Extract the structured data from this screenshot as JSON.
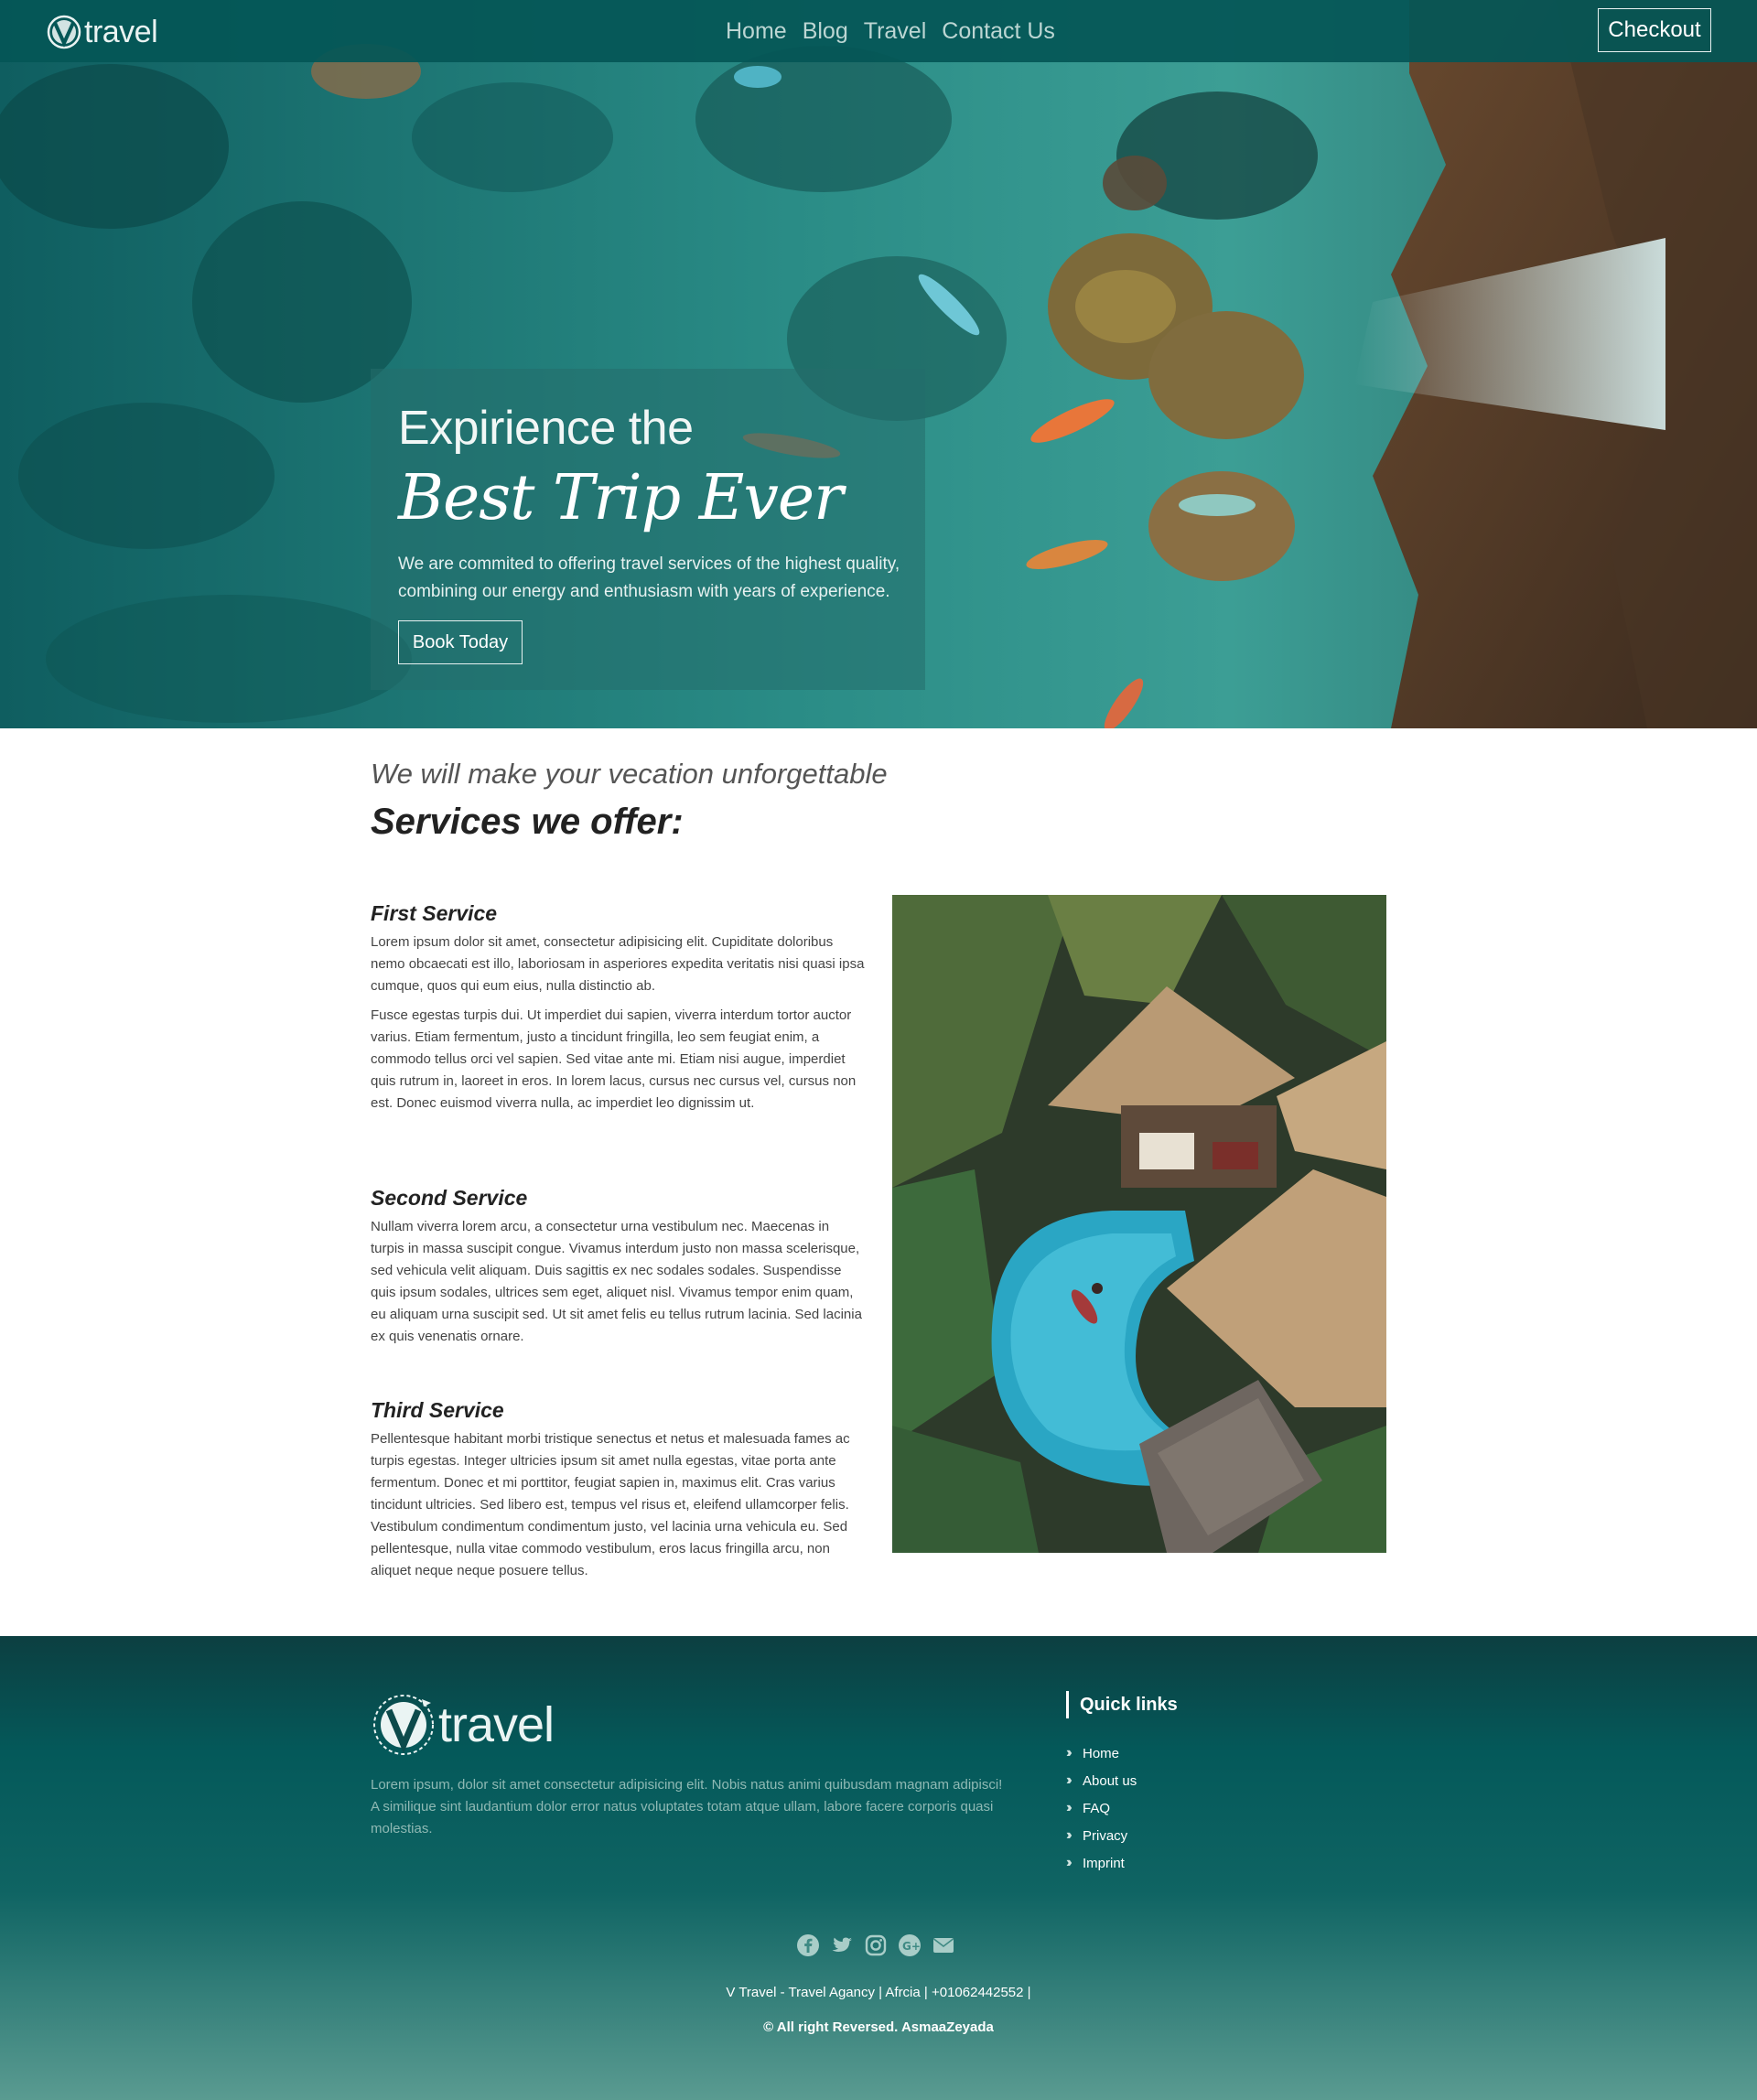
{
  "brand": {
    "logo_text": "travel"
  },
  "nav": {
    "links": [
      "Home",
      "Blog",
      "Travel",
      "Contact Us"
    ],
    "checkout_label": "Checkout"
  },
  "hero": {
    "line1": "Expirience the",
    "line2": "Best Trip Ever",
    "text": "We are commited to offering travel services of the highest quality, combining our energy and enthusiasm with years of experience.",
    "button": "Book Today",
    "image": "aerial-kayaks-coast"
  },
  "services": {
    "tagline": "We will make your vecation unforgettable",
    "title": "Services we offer:",
    "image": "resort-pool-huts",
    "items": [
      {
        "title": "First Service",
        "paragraphs": [
          "Lorem ipsum dolor sit amet, consectetur adipisicing elit. Cupiditate doloribus nemo obcaecati est illo, laboriosam in asperiores expedita veritatis nisi quasi ipsa cumque, quos qui eum eius, nulla distinctio ab.",
          "Fusce egestas turpis dui. Ut imperdiet dui sapien, viverra interdum tortor auctor varius. Etiam fermentum, justo a tincidunt fringilla, leo sem feugiat enim, a commodo tellus orci vel sapien. Sed vitae ante mi. Etiam nisi augue, imperdiet quis rutrum in, laoreet in eros. In lorem lacus, cursus nec cursus vel, cursus non est. Donec euismod viverra nulla, ac imperdiet leo dignissim ut."
        ]
      },
      {
        "title": "Second Service",
        "paragraphs": [
          "Nullam viverra lorem arcu, a consectetur urna vestibulum nec. Maecenas in turpis in massa suscipit congue. Vivamus interdum justo non massa scelerisque, sed vehicula velit aliquam. Duis sagittis ex nec sodales sodales. Suspendisse quis ipsum sodales, ultrices sem eget, aliquet nisl. Vivamus tempor enim quam, eu aliquam urna suscipit sed. Ut sit amet felis eu tellus rutrum lacinia. Sed lacinia ex quis venenatis ornare."
        ]
      },
      {
        "title": "Third Service",
        "paragraphs": [
          "Pellentesque habitant morbi tristique senectus et netus et malesuada fames ac turpis egestas. Integer ultricies ipsum sit amet nulla egestas, vitae porta ante fermentum. Donec et mi porttitor, feugiat sapien in, maximus elit. Cras varius tincidunt ultricies. Sed libero est, tempus vel risus et, eleifend ullamcorper felis. Vestibulum condimentum condimentum justo, vel lacinia urna vehicula eu. Sed pellentesque, nulla vitae commodo vestibulum, eros lacus fringilla arcu, non aliquet neque neque posuere tellus."
        ]
      }
    ]
  },
  "footer": {
    "logo_text": "travel",
    "description": "Lorem ipsum, dolor sit amet consectetur adipisicing elit. Nobis natus animi quibusdam magnam adipisci! A similique sint laudantium dolor error natus voluptates totam atque ullam, labore facere corporis quasi molestias.",
    "quick_links_title": "Quick links",
    "quick_links": [
      "Home",
      "About us",
      "FAQ",
      "Privacy",
      "Imprint"
    ],
    "social_icons": [
      "facebook-icon",
      "twitter-icon",
      "instagram-icon",
      "google-plus-icon",
      "envelope-icon"
    ],
    "info": "V Travel - Travel Agancy | Afrcia | +01062442552 |",
    "copyright": "© All right Reversed.  AsmaaZeyada"
  },
  "colors": {
    "nav_bg": "#045656",
    "footer_top": "#0c3f41",
    "footer_bottom": "#5a9b91",
    "accent": "#ffffff"
  }
}
